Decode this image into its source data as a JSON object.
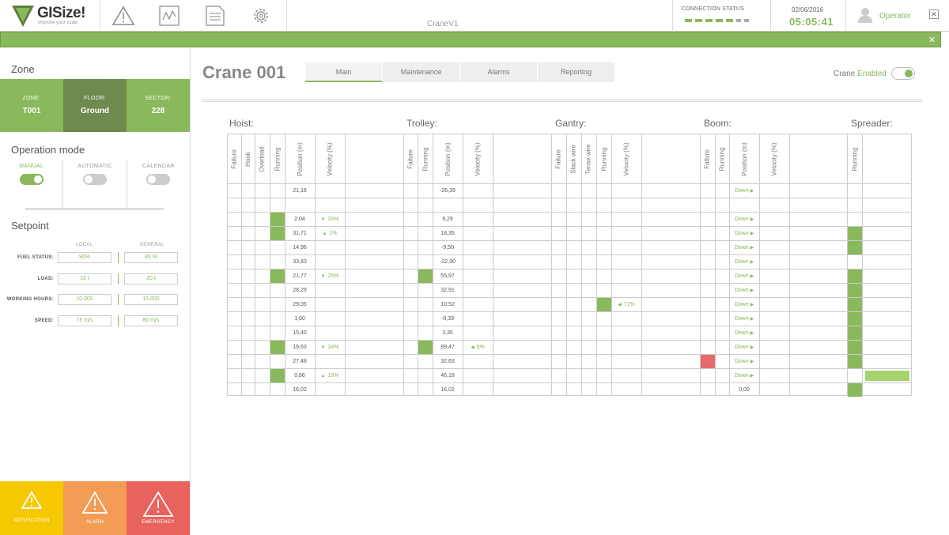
{
  "header": {
    "brand": "GISize!",
    "tagline": "improve your scale",
    "app_title": "CraneV1",
    "connection_label": "CONNECTION STATUS",
    "date": "02/06/2016",
    "time": "05:05:41",
    "user": "Operator",
    "nav_icons": [
      "warning-icon",
      "chart-icon",
      "document-icon",
      "gear-icon"
    ]
  },
  "colors": {
    "accent": "#8ab85c",
    "notification": "#f5c800",
    "alarm": "#f39c55",
    "emergency": "#e8625e",
    "failure": "#e86a6a"
  },
  "sidebar": {
    "zone_heading": "Zone",
    "zone": [
      {
        "label": "ZONE:",
        "value": "T001"
      },
      {
        "label": "FLOOR:",
        "value": "Ground"
      },
      {
        "label": "SECTOR:",
        "value": "228"
      }
    ],
    "operation_heading": "Operation mode",
    "modes": [
      {
        "label": "MANUAL",
        "on": true
      },
      {
        "label": "AUTOMATIC",
        "on": false
      },
      {
        "label": "CALENDAR",
        "on": false
      }
    ],
    "setpoint_heading": "Setpoint",
    "col_local": "LOCAL",
    "col_general": "GENERAL",
    "setpoints": [
      {
        "label": "FUEL STATUS:",
        "local": "90%",
        "general": "85 %"
      },
      {
        "label": "LOAD:",
        "local": "15 t",
        "general": "20 t"
      },
      {
        "label": "WORKING HOURS:",
        "local": "10.000",
        "general": "15.000"
      },
      {
        "label": "SPEED:",
        "local": "75 m/s",
        "general": "80 m/s"
      }
    ],
    "alerts": [
      {
        "label": "NOTIFICATION"
      },
      {
        "label": "ALARM"
      },
      {
        "label": "EMERGENCY"
      }
    ]
  },
  "main": {
    "title": "Crane 001",
    "tabs": [
      "Main",
      "Maintenance",
      "Alarms",
      "Reporting"
    ],
    "crane_label": "Crane",
    "crane_state": "Enabled",
    "groups": [
      "Hoist:",
      "Trolley:",
      "Gantry:",
      "Boom:",
      "Spreader:"
    ],
    "columns": {
      "hoist": [
        "Failure",
        "Hook",
        "Overload",
        "Running",
        "Position (m)",
        "Velocity (%)"
      ],
      "trolley": [
        "Failure",
        "Running",
        "Position (m)",
        "Velocity (%)"
      ],
      "gantry": [
        "Failure",
        "Slack wire",
        "Tense wire",
        "Running",
        "Velocity (%)"
      ],
      "boom": [
        "Failure",
        "Running",
        "Position (m)",
        "Velocity (%)"
      ],
      "spreader": [
        "Running"
      ]
    },
    "rows": [
      {
        "h_run": false,
        "h_pos": "21,16",
        "h_vel": "",
        "h_dir": "",
        "t_run": false,
        "t_pos": "-26,39",
        "t_vel": "",
        "g_run": false,
        "g_vel": "",
        "b_fail": false,
        "b_pos": "Down",
        "s_run": false
      },
      {
        "h_run": false,
        "h_pos": "",
        "h_vel": "",
        "h_dir": "",
        "t_run": false,
        "t_pos": "",
        "t_vel": "",
        "g_run": false,
        "g_vel": "",
        "b_fail": false,
        "b_pos": "",
        "s_run": false
      },
      {
        "h_run": true,
        "h_pos": "2,04",
        "h_vel": "26%",
        "h_dir": "down",
        "t_run": false,
        "t_pos": "9,29",
        "t_vel": "",
        "g_run": false,
        "g_vel": "",
        "b_fail": false,
        "b_pos": "Down",
        "s_run": false
      },
      {
        "h_run": true,
        "h_pos": "31,71",
        "h_vel": "1%",
        "h_dir": "up",
        "t_run": false,
        "t_pos": "18,35",
        "t_vel": "",
        "g_run": false,
        "g_vel": "",
        "b_fail": false,
        "b_pos": "Down",
        "s_run": true
      },
      {
        "h_run": false,
        "h_pos": "14,96",
        "h_vel": "",
        "h_dir": "",
        "t_run": false,
        "t_pos": "-9,50",
        "t_vel": "",
        "g_run": false,
        "g_vel": "",
        "b_fail": false,
        "b_pos": "Down",
        "s_run": true
      },
      {
        "h_run": false,
        "h_pos": "33,83",
        "h_vel": "",
        "h_dir": "",
        "t_run": false,
        "t_pos": "-22,90",
        "t_vel": "",
        "g_run": false,
        "g_vel": "",
        "b_fail": false,
        "b_pos": "Down",
        "s_run": false
      },
      {
        "h_run": true,
        "h_pos": "21,77",
        "h_vel": "25%",
        "h_dir": "down",
        "t_run": true,
        "t_pos": "55,97",
        "t_vel": "",
        "g_run": false,
        "g_vel": "",
        "b_fail": false,
        "b_pos": "Down",
        "s_run": true
      },
      {
        "h_run": false,
        "h_pos": "28,29",
        "h_vel": "",
        "h_dir": "",
        "t_run": false,
        "t_pos": "32,91",
        "t_vel": "",
        "g_run": false,
        "g_vel": "",
        "b_fail": false,
        "b_pos": "Down",
        "s_run": true
      },
      {
        "h_run": false,
        "h_pos": "29,05",
        "h_vel": "",
        "h_dir": "",
        "t_run": false,
        "t_pos": "10,52",
        "t_vel": "",
        "g_run": true,
        "g_vel": "71%",
        "b_fail": false,
        "b_pos": "Down",
        "s_run": true
      },
      {
        "h_run": false,
        "h_pos": "1,60",
        "h_vel": "",
        "h_dir": "",
        "t_run": false,
        "t_pos": "-0,39",
        "t_vel": "",
        "g_run": false,
        "g_vel": "",
        "b_fail": false,
        "b_pos": "Down",
        "s_run": true
      },
      {
        "h_run": false,
        "h_pos": "15,40",
        "h_vel": "",
        "h_dir": "",
        "t_run": false,
        "t_pos": "3,35",
        "t_vel": "",
        "g_run": false,
        "g_vel": "",
        "b_fail": false,
        "b_pos": "Down",
        "s_run": true
      },
      {
        "h_run": true,
        "h_pos": "19,63",
        "h_vel": "34%",
        "h_dir": "down",
        "t_run": true,
        "t_pos": "89,47",
        "t_vel": "6%",
        "g_run": false,
        "g_vel": "",
        "b_fail": false,
        "b_pos": "Down",
        "s_run": true
      },
      {
        "h_run": false,
        "h_pos": "27,48",
        "h_vel": "",
        "h_dir": "",
        "t_run": false,
        "t_pos": "32,63",
        "t_vel": "",
        "g_run": false,
        "g_vel": "",
        "b_fail": true,
        "b_pos": "Down",
        "s_run": true
      },
      {
        "h_run": true,
        "h_pos": "0,86",
        "h_vel": "15%",
        "h_dir": "up",
        "t_run": false,
        "t_pos": "46,18",
        "t_vel": "",
        "g_run": false,
        "g_vel": "",
        "b_fail": false,
        "b_pos": "Down",
        "s_run": false,
        "s_bar": true
      },
      {
        "h_run": false,
        "h_pos": "16,02",
        "h_vel": "",
        "h_dir": "",
        "t_run": false,
        "t_pos": "16,02",
        "t_vel": "",
        "g_run": false,
        "g_vel": "",
        "b_fail": false,
        "b_pos": "0,00",
        "s_run": true
      }
    ]
  }
}
